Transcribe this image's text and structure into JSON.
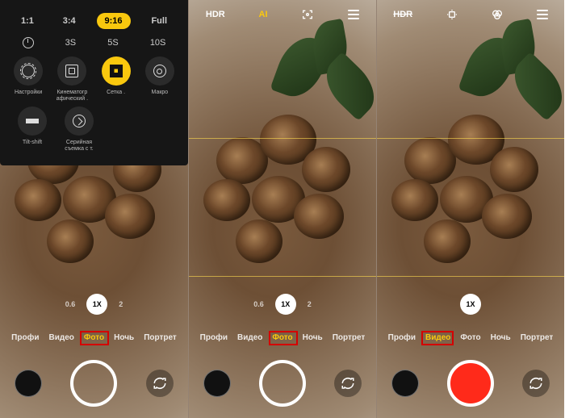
{
  "accent": "#f9c80e",
  "screens": [
    {
      "id": "settings-panel",
      "aspect_row": {
        "options": [
          "1:1",
          "3:4",
          "9:16",
          "Full"
        ],
        "selected_index": 2
      },
      "timer_row": {
        "icon": "timer-icon",
        "options": [
          "3S",
          "5S",
          "10S"
        ]
      },
      "tiles_row1": [
        {
          "icon": "gear-icon",
          "label": "Настройки"
        },
        {
          "icon": "frame-icon",
          "label": "Кинематогр афический ."
        },
        {
          "icon": "grid-icon",
          "label": "Сетка .",
          "active": true
        },
        {
          "icon": "flower-icon",
          "label": "Макро"
        }
      ],
      "tiles_row2": [
        {
          "icon": "tilt-icon",
          "label": "Tilt-shift"
        },
        {
          "icon": "burst-icon",
          "label": "Серийная съемка с т."
        }
      ],
      "zoom": {
        "left": "0.6",
        "chip": "1X",
        "right": "2"
      },
      "modes": [
        "Профи",
        "Видео",
        "Фото",
        "Ночь",
        "Портрет"
      ],
      "selected_mode_index": 2,
      "highlight_mode_index": 2,
      "shutter": "photo"
    },
    {
      "id": "photo-mode",
      "topbar": [
        {
          "kind": "text",
          "value": "HDR"
        },
        {
          "kind": "text",
          "value": "AI",
          "active": true
        },
        {
          "kind": "icon",
          "name": "focus-icon"
        },
        {
          "kind": "icon",
          "name": "menu-icon"
        }
      ],
      "zoom": {
        "left": "0.6",
        "chip": "1X",
        "right": "2"
      },
      "modes": [
        "Профи",
        "Видео",
        "Фото",
        "Ночь",
        "Портрет"
      ],
      "selected_mode_index": 2,
      "highlight_mode_index": 2,
      "shutter": "photo"
    },
    {
      "id": "video-mode",
      "topbar": [
        {
          "kind": "text",
          "value": "HDR",
          "strike": true
        },
        {
          "kind": "icon",
          "name": "stabilize-icon"
        },
        {
          "kind": "icon",
          "name": "filters-icon"
        },
        {
          "kind": "icon",
          "name": "menu-icon"
        }
      ],
      "zoom": {
        "chip": "1X"
      },
      "modes": [
        "Профи",
        "Видео",
        "Фото",
        "Ночь",
        "Портрет"
      ],
      "selected_mode_index": 1,
      "highlight_mode_index": 1,
      "shutter": "video"
    }
  ]
}
